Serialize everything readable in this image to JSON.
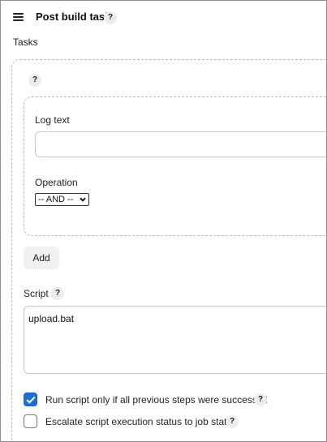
{
  "section": {
    "title": "Post build task",
    "help": "?"
  },
  "tasks": {
    "label": "Tasks",
    "help": "?",
    "log_text": {
      "label": "Log text",
      "value": ""
    },
    "operation": {
      "label": "Operation",
      "selected": "-- AND --"
    },
    "add_label": "Add"
  },
  "script": {
    "label": "Script",
    "help": "?",
    "value": "upload.bat"
  },
  "options": {
    "run_only_if_success": {
      "label": "Run script only if all previous steps were successful",
      "checked": true,
      "help": "?"
    },
    "escalate_status": {
      "label": "Escalate script execution status to job status",
      "checked": false,
      "help": "?"
    }
  },
  "icons": {
    "drag_handle": "hamburger-icon",
    "help": "question-icon",
    "select_arrow": "chevron-down-icon",
    "check": "check-icon"
  },
  "colors": {
    "checkbox_checked": "#1f6fd6",
    "help_bg": "#ececec",
    "border": "#c8c8c8"
  }
}
